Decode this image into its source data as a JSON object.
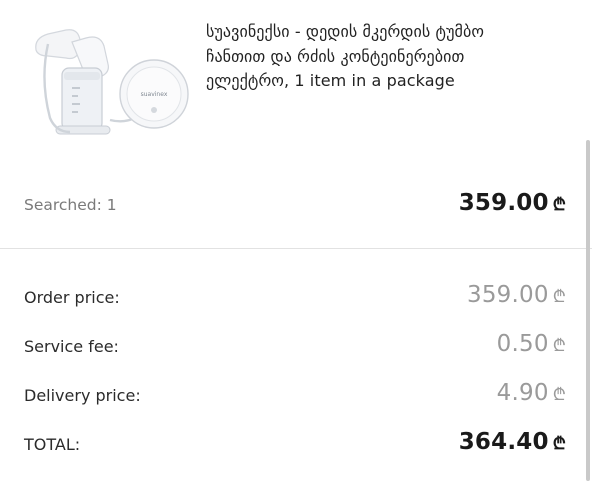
{
  "product": {
    "title_line1": "სუავინექსი - დედის მკერდის ტუმბო",
    "title_line2": "ჩანთით და რძის კონტეინერებით",
    "title_line3": "ელექტრო, 1 item in a package",
    "image_icon": "breast-pump-product-photo",
    "device_brand": "suavinex"
  },
  "searched": {
    "label": "Searched:",
    "count": "1",
    "value": "359.00",
    "currency": "₾"
  },
  "summary": {
    "order_price_label": "Order price:",
    "order_price_value": "359.00",
    "service_fee_label": "Service fee:",
    "service_fee_value": "0.50",
    "delivery_price_label": "Delivery price:",
    "delivery_price_value": "4.90",
    "total_label": "TOTAL:",
    "total_value": "364.40",
    "currency": "₾"
  },
  "colors": {
    "muted_text": "#9a9a9a",
    "primary_text": "#1a1a1a",
    "divider": "#e2e2e2"
  }
}
